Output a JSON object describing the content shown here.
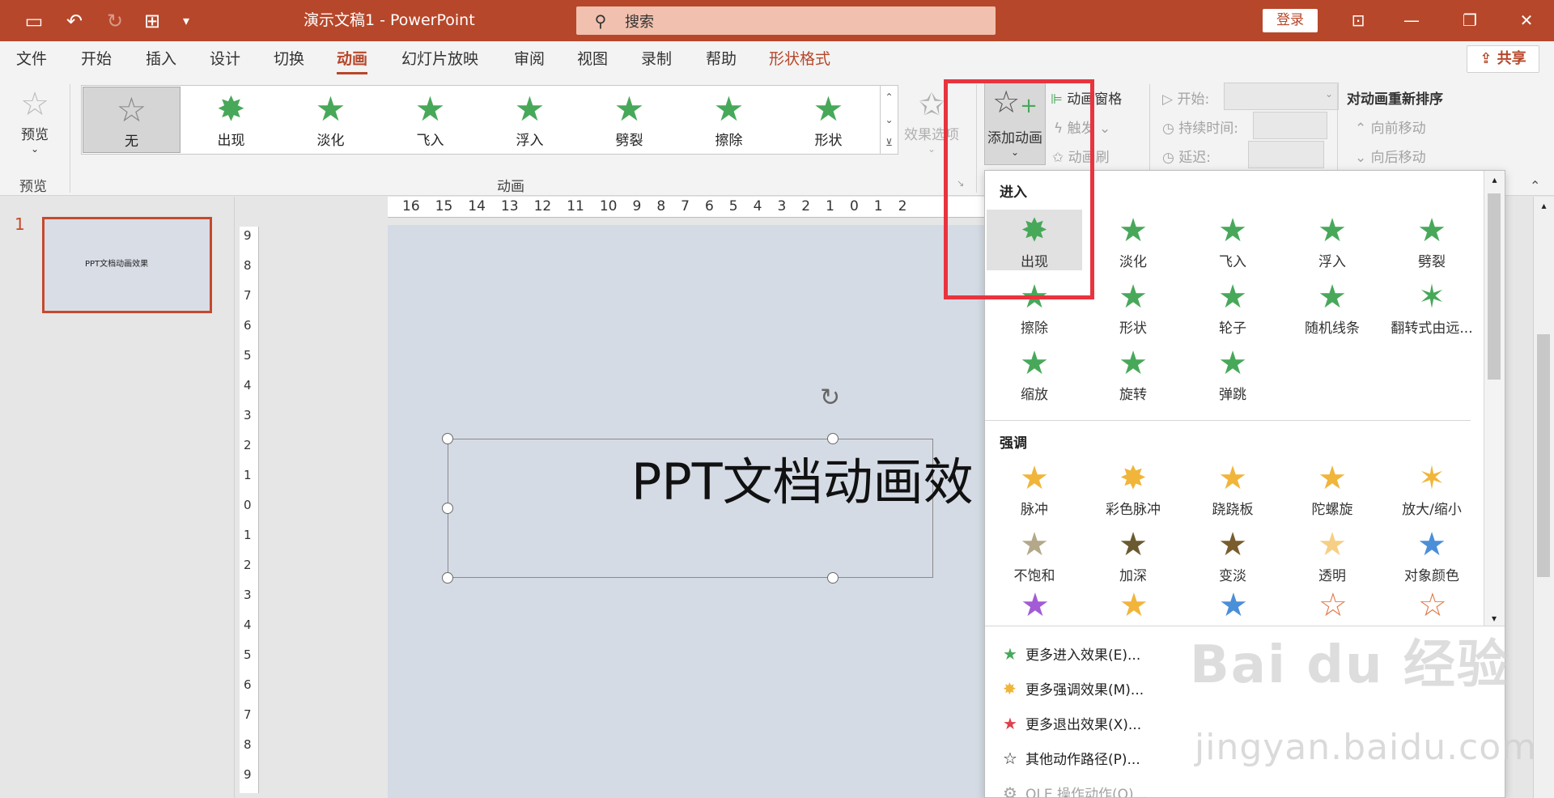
{
  "titlebar": {
    "doc_title": "演示文稿1  -  PowerPoint",
    "search_placeholder": "搜索",
    "login": "登录",
    "icons": [
      "save-icon",
      "undo-icon",
      "redo-icon",
      "present-icon",
      "customize-icon"
    ]
  },
  "tabs": [
    {
      "label": "文件"
    },
    {
      "label": "开始"
    },
    {
      "label": "插入"
    },
    {
      "label": "设计"
    },
    {
      "label": "切换"
    },
    {
      "label": "动画"
    },
    {
      "label": "幻灯片放映"
    },
    {
      "label": "审阅"
    },
    {
      "label": "视图"
    },
    {
      "label": "录制"
    },
    {
      "label": "帮助"
    },
    {
      "label": "形状格式"
    }
  ],
  "share_label": "共享",
  "ribbon": {
    "preview_label": "预览",
    "preview_group": "预览",
    "animation_group": "动画",
    "gallery": [
      {
        "label": "无"
      },
      {
        "label": "出现"
      },
      {
        "label": "淡化"
      },
      {
        "label": "飞入"
      },
      {
        "label": "浮入"
      },
      {
        "label": "劈裂"
      },
      {
        "label": "擦除"
      },
      {
        "label": "形状"
      }
    ],
    "effect_options": "效果选项",
    "add_animation": "添加动画",
    "animation_pane": "动画窗格",
    "trigger": "触发",
    "animation_painter": "动画刷",
    "start_label": "开始:",
    "duration_label": "持续时间:",
    "delay_label": "延迟:",
    "reorder_title": "对动画重新排序",
    "move_earlier": "向前移动",
    "move_later": "向后移动"
  },
  "slide": {
    "number": "1",
    "thumb_text": "PPT文档动画效果",
    "title_text": "PPT文档动画效"
  },
  "dropdown": {
    "entrance_header": "进入",
    "entrance": [
      {
        "label": "出现"
      },
      {
        "label": "淡化"
      },
      {
        "label": "飞入"
      },
      {
        "label": "浮入"
      },
      {
        "label": "劈裂"
      },
      {
        "label": "擦除"
      },
      {
        "label": "形状"
      },
      {
        "label": "轮子"
      },
      {
        "label": "随机线条"
      },
      {
        "label": "翻转式由远..."
      },
      {
        "label": "缩放"
      },
      {
        "label": "旋转"
      },
      {
        "label": "弹跳"
      }
    ],
    "emphasis_header": "强调",
    "emphasis": [
      {
        "label": "脉冲"
      },
      {
        "label": "彩色脉冲"
      },
      {
        "label": "跷跷板"
      },
      {
        "label": "陀螺旋"
      },
      {
        "label": "放大/缩小"
      },
      {
        "label": "不饱和"
      },
      {
        "label": "加深"
      },
      {
        "label": "变淡"
      },
      {
        "label": "透明"
      },
      {
        "label": "对象颜色"
      }
    ],
    "more": [
      {
        "label": "更多进入效果(E)..."
      },
      {
        "label": "更多强调效果(M)..."
      },
      {
        "label": "更多退出效果(X)..."
      },
      {
        "label": "其他动作路径(P)..."
      },
      {
        "label": "OLE 操作动作(O)..."
      }
    ]
  },
  "ruler": {
    "h_ticks": [
      "16",
      "15",
      "14",
      "13",
      "12",
      "11",
      "10",
      "9",
      "8",
      "7",
      "6",
      "5",
      "4",
      "3",
      "2",
      "1",
      "0",
      "1",
      "2"
    ],
    "v_ticks": [
      "9",
      "8",
      "7",
      "6",
      "5",
      "4",
      "3",
      "2",
      "1",
      "0",
      "1",
      "2",
      "3",
      "4",
      "5",
      "6",
      "7",
      "8",
      "9"
    ]
  },
  "watermark": {
    "main": "Bai du 经验",
    "sub": "jingyan.baidu.com"
  },
  "colors": {
    "accent": "#b7472a",
    "highlight": "#e8343e",
    "green_star": "#48a85a",
    "gold_star": "#f0b53a"
  }
}
